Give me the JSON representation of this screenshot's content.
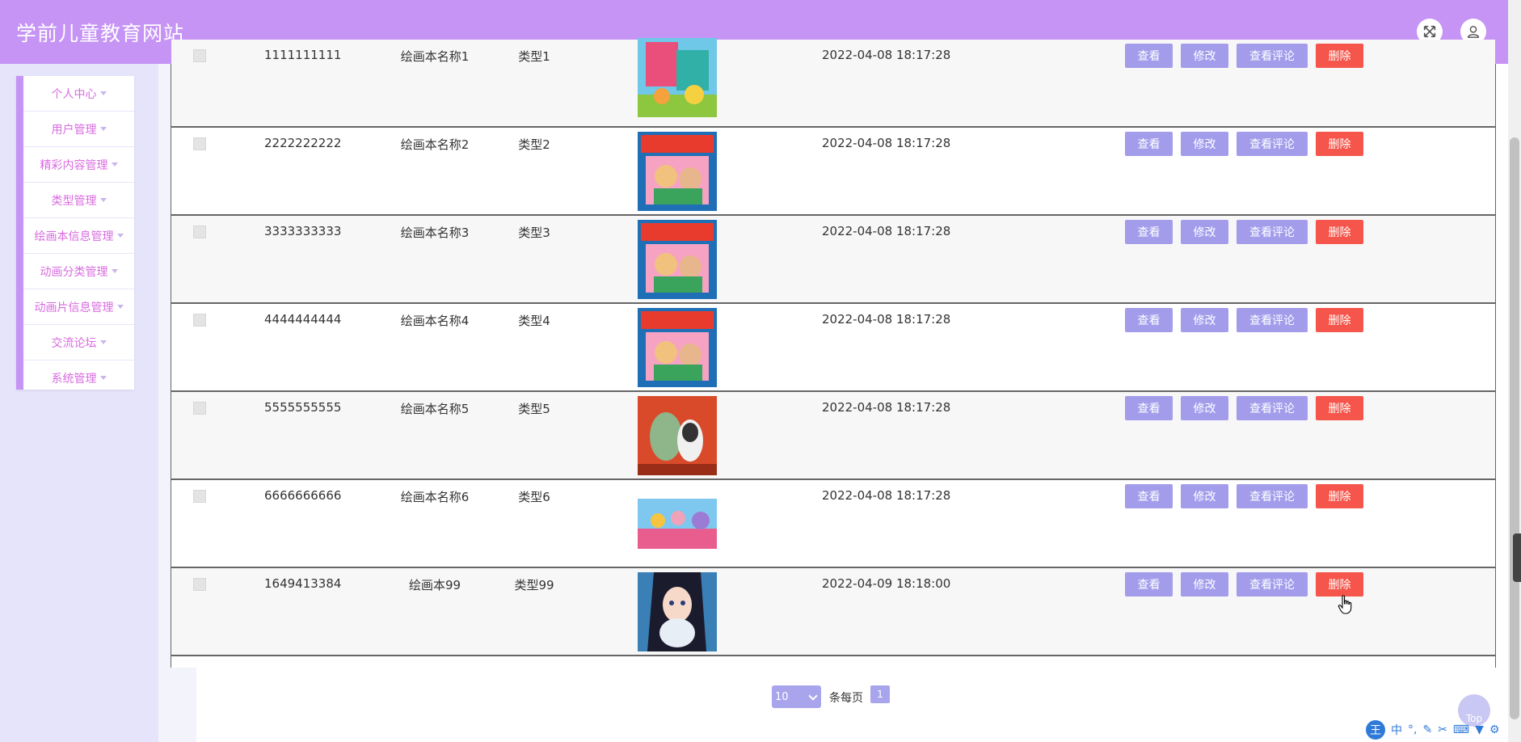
{
  "header": {
    "title": "学前儿童教育网站",
    "fullscreen_icon": "expand-icon",
    "user_icon": "user-icon"
  },
  "sidebar": {
    "items": [
      {
        "label": "个人中心"
      },
      {
        "label": "用户管理"
      },
      {
        "label": "精彩内容管理"
      },
      {
        "label": "类型管理"
      },
      {
        "label": "绘画本信息管理"
      },
      {
        "label": "动画分类管理"
      },
      {
        "label": "动画片信息管理"
      },
      {
        "label": "交流论坛"
      },
      {
        "label": "系统管理"
      }
    ]
  },
  "table": {
    "actions": {
      "view": "查看",
      "edit": "修改",
      "comments": "查看评论",
      "delete": "删除"
    },
    "rows": [
      {
        "id": "1111111111",
        "name": "绘画本名称1",
        "type": "类型1",
        "time": "2022-04-08 18:17:28"
      },
      {
        "id": "2222222222",
        "name": "绘画本名称2",
        "type": "类型2",
        "time": "2022-04-08 18:17:28"
      },
      {
        "id": "3333333333",
        "name": "绘画本名称3",
        "type": "类型3",
        "time": "2022-04-08 18:17:28"
      },
      {
        "id": "4444444444",
        "name": "绘画本名称4",
        "type": "类型4",
        "time": "2022-04-08 18:17:28"
      },
      {
        "id": "5555555555",
        "name": "绘画本名称5",
        "type": "类型5",
        "time": "2022-04-08 18:17:28"
      },
      {
        "id": "6666666666",
        "name": "绘画本名称6",
        "type": "类型6",
        "time": "2022-04-08 18:17:28"
      },
      {
        "id": "1649413384",
        "name": "绘画本99",
        "type": "类型99",
        "time": "2022-04-09 18:18:00"
      }
    ]
  },
  "pagination": {
    "page_size": "10",
    "per_page_label": "条每页",
    "current_page": "1"
  },
  "back_to_top": "Top",
  "ime_toolbar": {
    "logo": "王",
    "lang": "中"
  },
  "colors": {
    "header": "#c594f5",
    "primary_button": "#a29ceb",
    "danger_button": "#f5554a",
    "menu_text": "#d86be0"
  }
}
